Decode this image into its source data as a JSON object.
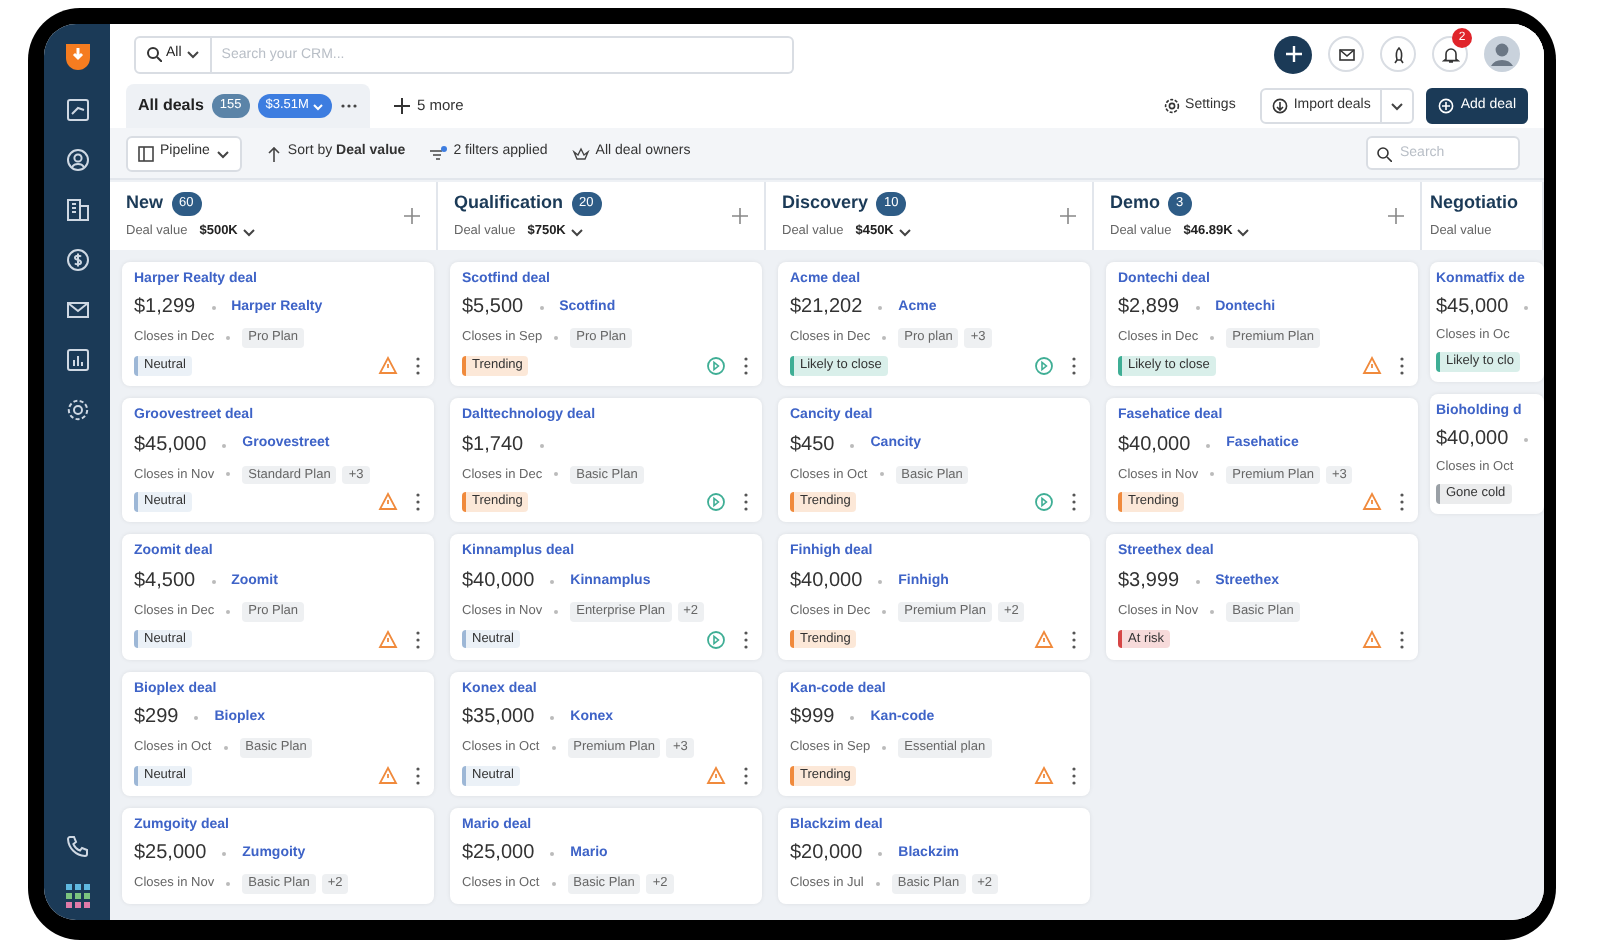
{
  "top_bar": {
    "search_scope": "All",
    "search_placeholder": "Search your CRM...",
    "notification_count": "2"
  },
  "tabs": [
    {
      "label": "All deals",
      "selected": true,
      "count": "155",
      "value": "$3.51M"
    }
  ],
  "more_views": "5 more",
  "actions": {
    "settings": "Settings",
    "import": "Import deals",
    "add": "Add deal"
  },
  "toolbar": {
    "view": "Pipeline",
    "sort_prefix": "Sort by",
    "sort_field": "Deal value",
    "filters": "2 filters applied",
    "owners": "All deal owners",
    "search_placeholder": "Search"
  },
  "columns": [
    {
      "name": "New",
      "count": "60",
      "value_label": "Deal value",
      "value": "$500K",
      "cards": [
        {
          "kind": "warning",
          "title": "Harper Realty deal",
          "amount": "$1,299",
          "company": "Harper Realty",
          "closes": "Closes in Dec",
          "plan": "Pro Plan",
          "status": {
            "label": "Neutral",
            "color": "#9db7d6"
          }
        },
        {
          "kind": "warning",
          "title": "Groovestreet deal",
          "amount": "$45,000",
          "company": "Groovestreet",
          "closes": "Closes in Nov",
          "plan": "Standard Plan",
          "extra": "+3",
          "status": {
            "label": "Neutral",
            "color": "#9db7d6"
          }
        },
        {
          "kind": "warning",
          "title": "Zoomit deal",
          "amount": "$4,500",
          "company": "Zoomit",
          "closes": "Closes in Dec",
          "plan": "Pro Plan",
          "status": {
            "label": "Neutral",
            "color": "#9db7d6"
          }
        },
        {
          "kind": "warning",
          "title": "Bioplex deal",
          "amount": "$299",
          "company": "Bioplex",
          "closes": "Closes in Oct",
          "plan": "Basic Plan",
          "status": {
            "label": "Neutral",
            "color": "#9db7d6"
          }
        },
        {
          "title": "Zumgoity deal",
          "amount": "$25,000",
          "company": "Zumgoity",
          "closes": "Closes in Nov",
          "plan": "Basic Plan",
          "extra": "+2"
        }
      ]
    },
    {
      "name": "Qualification",
      "count": "20",
      "value_label": "Deal value",
      "value": "$750K",
      "cards": [
        {
          "kind": "progress",
          "title": "Scotfind deal",
          "amount": "$5,500",
          "company": "Scotfind",
          "closes": "Closes in Sep",
          "plan": "Pro Plan",
          "status": {
            "label": "Trending",
            "color": "#f08a3c"
          }
        },
        {
          "kind": "progress",
          "title": "Dalttechnology deal",
          "amount": "$1,740",
          "closes": "Closes in Dec",
          "plan": "Basic Plan",
          "status": {
            "label": "Trending",
            "color": "#f08a3c"
          }
        },
        {
          "kind": "progress",
          "title": "Kinnamplus deal",
          "amount": "$40,000",
          "company": "Kinnamplus",
          "closes": "Closes in Nov",
          "plan": "Enterprise Plan",
          "extra": "+2",
          "status": {
            "label": "Neutral",
            "color": "#9db7d6"
          }
        },
        {
          "kind": "warning",
          "title": "Konex deal",
          "amount": "$35,000",
          "company": "Konex",
          "closes": "Closes in Oct",
          "plan": "Premium Plan",
          "extra": "+3",
          "status": {
            "label": "Neutral",
            "color": "#9db7d6"
          }
        },
        {
          "title": "Mario deal",
          "amount": "$25,000",
          "company": "Mario",
          "closes": "Closes in Oct",
          "plan": "Basic Plan",
          "extra": "+2"
        }
      ]
    },
    {
      "name": "Discovery",
      "count": "10",
      "value_label": "Deal value",
      "value": "$450K",
      "cards": [
        {
          "kind": "progress",
          "title": "Acme deal",
          "amount": "$21,202",
          "company": "Acme",
          "closes": "Closes in Dec",
          "plan": "Pro plan",
          "extra": "+3",
          "status": {
            "label": "Likely to close",
            "color": "#3fae95"
          }
        },
        {
          "kind": "progress",
          "title": "Cancity deal",
          "amount": "$450",
          "company": "Cancity",
          "closes": "Closes in Oct",
          "plan": "Basic Plan",
          "status": {
            "label": "Trending",
            "color": "#f08a3c"
          }
        },
        {
          "kind": "warning",
          "title": "Finhigh deal",
          "amount": "$40,000",
          "company": "Finhigh",
          "closes": "Closes in Dec",
          "plan": "Premium Plan",
          "extra": "+2",
          "status": {
            "label": "Trending",
            "color": "#f08a3c"
          }
        },
        {
          "kind": "warning",
          "title": "Kan-code deal",
          "amount": "$999",
          "company": "Kan-code",
          "closes": "Closes in Sep",
          "plan": "Essential plan",
          "status": {
            "label": "Trending",
            "color": "#f08a3c"
          }
        },
        {
          "title": "Blackzim deal",
          "amount": "$20,000",
          "company": "Blackzim",
          "closes": "Closes in Jul",
          "plan": "Basic Plan",
          "extra": "+2"
        }
      ]
    },
    {
      "name": "Demo",
      "count": "3",
      "value_label": "Deal value",
      "value": "$46.89K",
      "cards": [
        {
          "kind": "warning",
          "title": "Dontechi deal",
          "amount": "$2,899",
          "company": "Dontechi",
          "closes": "Closes in Dec",
          "plan": "Premium Plan",
          "status": {
            "label": "Likely to close",
            "color": "#3fae95"
          }
        },
        {
          "kind": "warning",
          "title": "Fasehatice deal",
          "amount": "$40,000",
          "company": "Fasehatice",
          "closes": "Closes in Nov",
          "plan": "Premium Plan",
          "extra": "+3",
          "status": {
            "label": "Trending",
            "color": "#f08a3c"
          }
        },
        {
          "kind": "warning",
          "title": "Streethex deal",
          "amount": "$3,999",
          "company": "Streethex",
          "closes": "Closes in Nov",
          "plan": "Basic Plan",
          "status": {
            "label": "At risk",
            "color": "#d64545"
          }
        }
      ]
    },
    {
      "name": "Negotiatio",
      "value_label": "Deal value",
      "cards": [
        {
          "title": "Konmatfix de",
          "amount": "$45,000",
          "closes": "Closes in Oc",
          "status": {
            "label": "Likely to clo",
            "color": "#3fae95"
          }
        },
        {
          "title": "Bioholding d",
          "amount": "$40,000",
          "closes": "Closes in Oct",
          "status": {
            "label": "Gone cold",
            "color": "#9aa0a6"
          }
        }
      ]
    }
  ]
}
